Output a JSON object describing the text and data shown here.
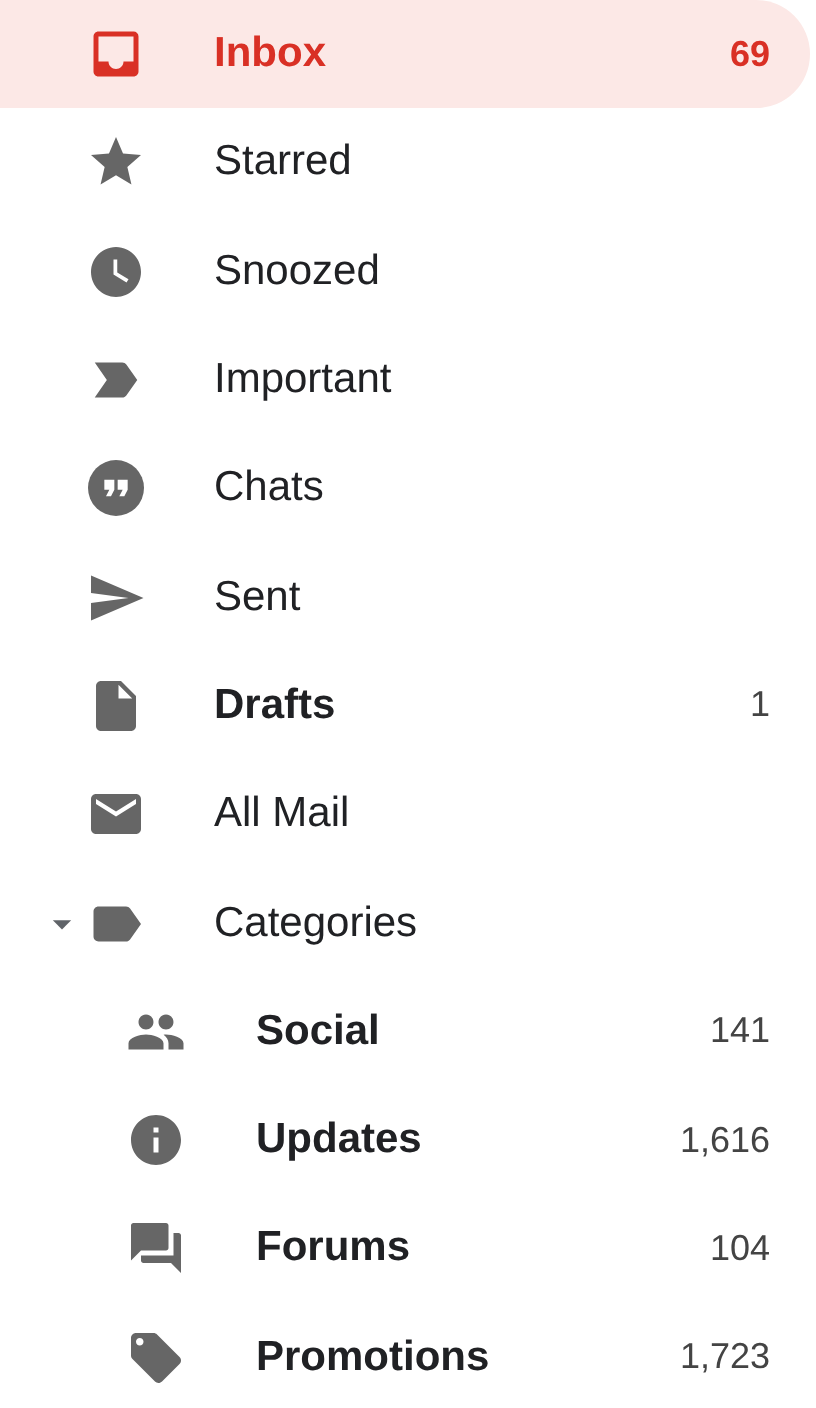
{
  "folders": [
    {
      "label": "Inbox",
      "count": "69",
      "selected": true,
      "bold": true
    },
    {
      "label": "Starred",
      "selected": false,
      "bold": false
    },
    {
      "label": "Snoozed",
      "selected": false,
      "bold": false
    },
    {
      "label": "Important",
      "selected": false,
      "bold": false
    },
    {
      "label": "Chats",
      "selected": false,
      "bold": false
    },
    {
      "label": "Sent",
      "selected": false,
      "bold": false
    },
    {
      "label": "Drafts",
      "count": "1",
      "selected": false,
      "bold": true
    },
    {
      "label": "All Mail",
      "selected": false,
      "bold": false
    },
    {
      "label": "Categories",
      "selected": false,
      "bold": false,
      "expanded": true,
      "children": [
        {
          "label": "Social",
          "count": "141",
          "selected": false,
          "bold": true
        },
        {
          "label": "Updates",
          "count": "1,616",
          "selected": false,
          "bold": true
        },
        {
          "label": "Forums",
          "count": "104",
          "selected": false,
          "bold": true
        },
        {
          "label": "Promotions",
          "count": "1,723",
          "selected": false,
          "bold": true
        }
      ]
    }
  ]
}
